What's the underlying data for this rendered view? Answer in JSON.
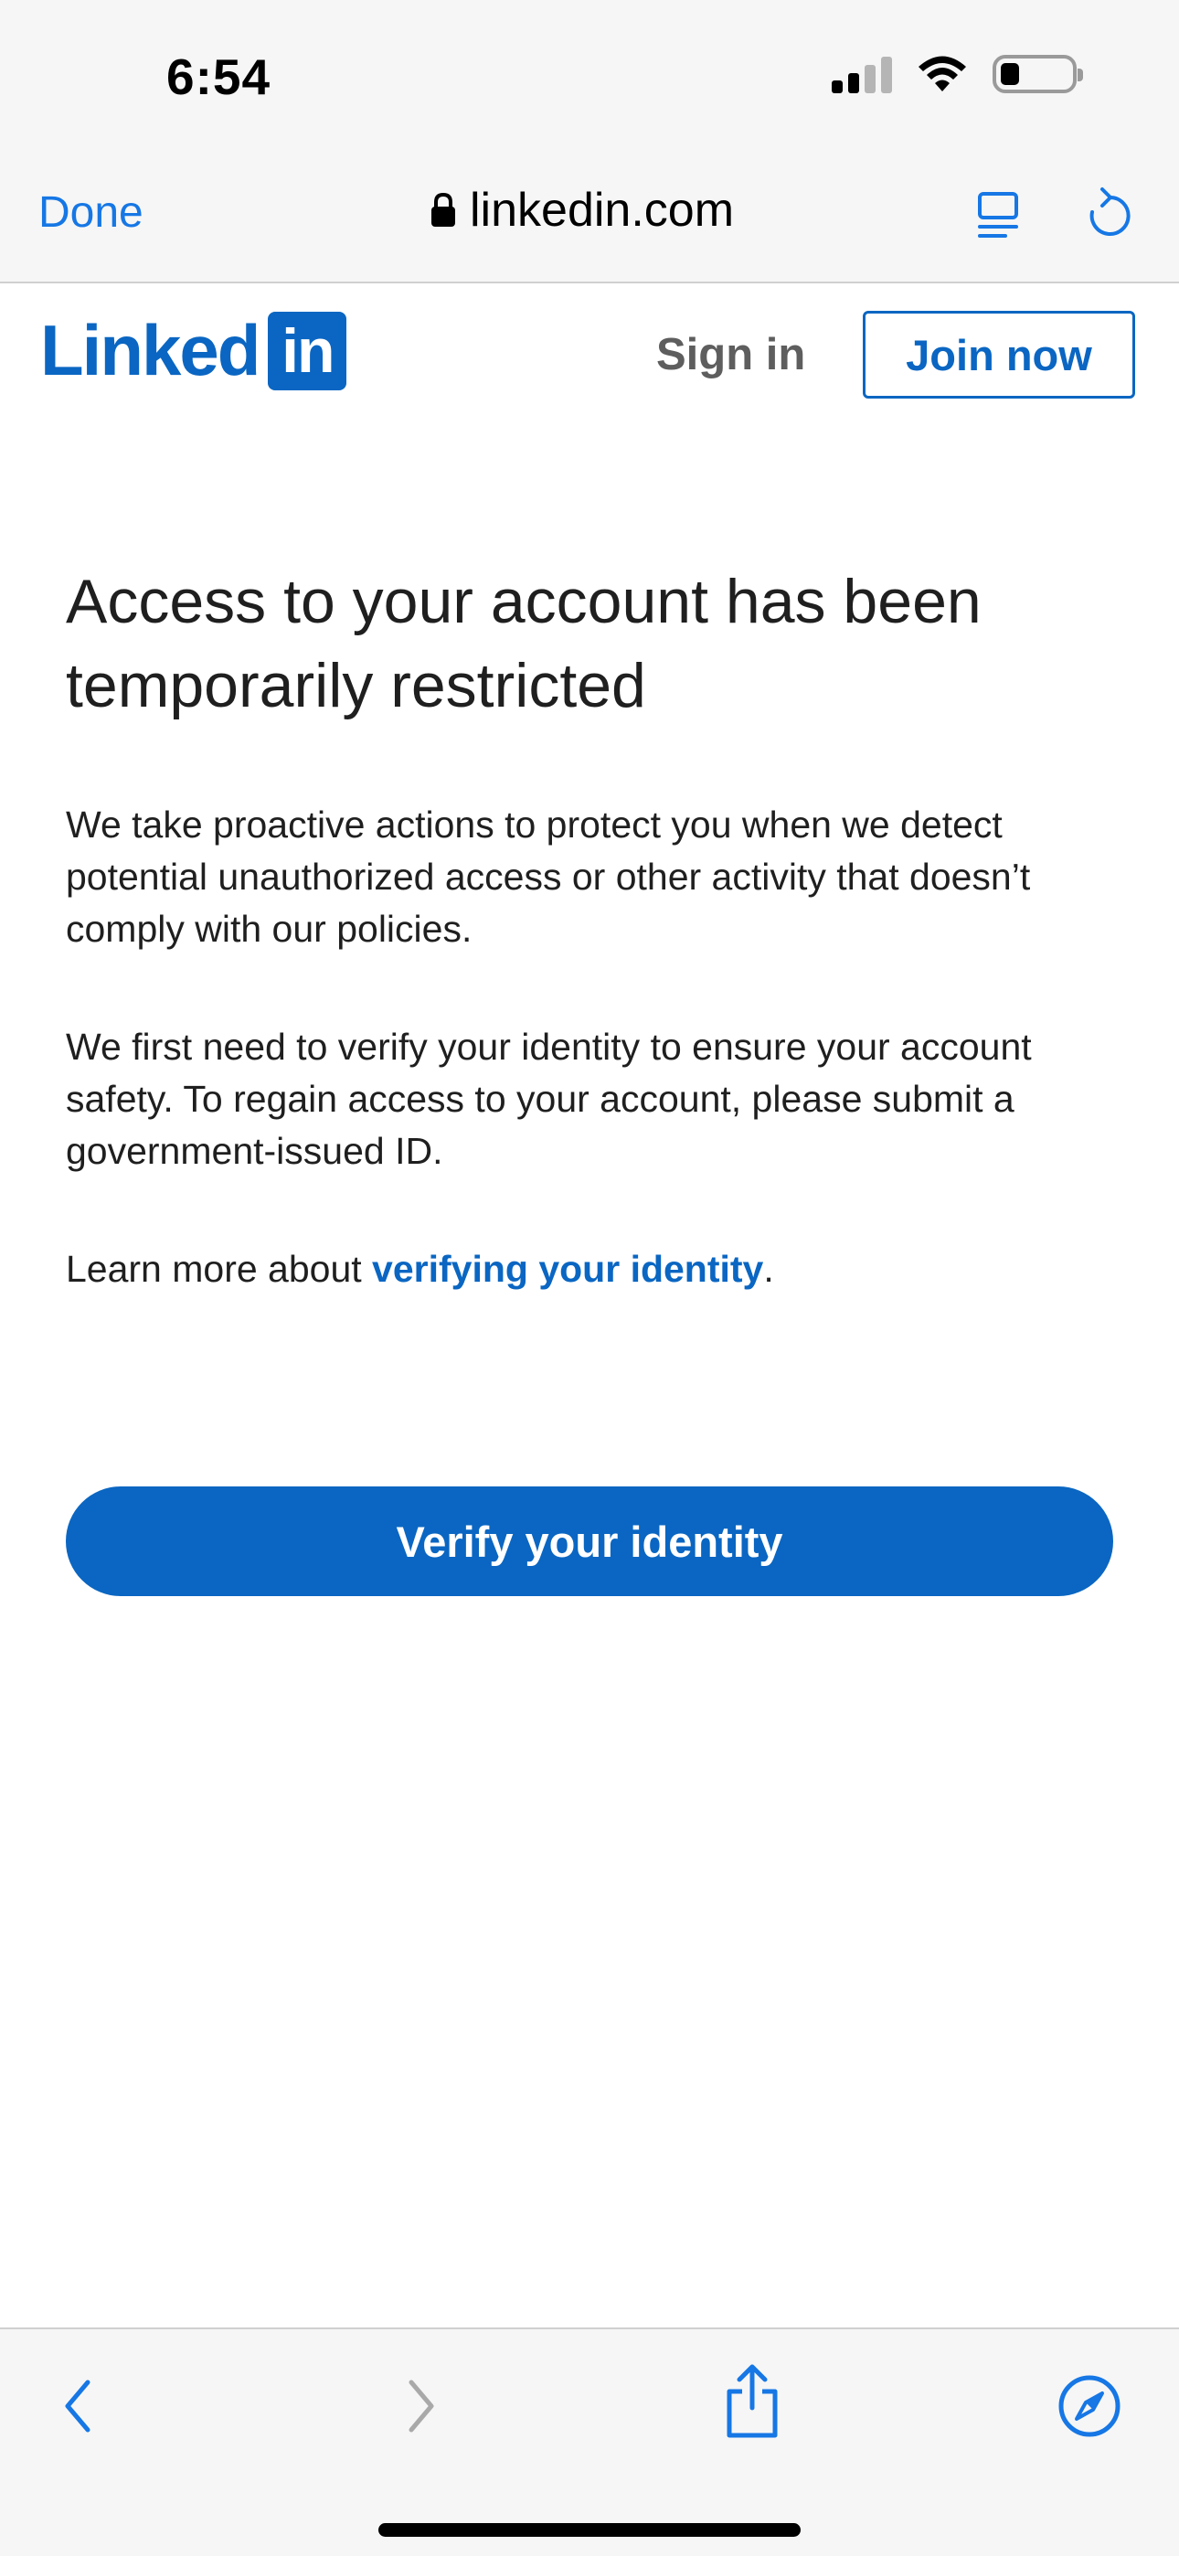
{
  "status_bar": {
    "time": "6:54"
  },
  "browser": {
    "done_label": "Done",
    "url": "linkedin.com",
    "accent_color": "#1677e5",
    "icons": [
      "lock-icon",
      "reader-icon",
      "reload-icon"
    ]
  },
  "header": {
    "logo_text": "Linked",
    "logo_box_text": "in",
    "sign_in_label": "Sign in",
    "join_label": "Join now",
    "brand_color": "#0a66c2"
  },
  "main": {
    "title": "Access to your account has been temporarily restricted",
    "paragraph1": "We take proactive actions to protect you when we detect potential unauthorized access or other activity that doesn’t comply with our policies.",
    "paragraph2": "We first need to verify your identity to ensure your account safety. To regain access to your account, please submit a government-issued ID.",
    "learn_prefix": "Learn more about ",
    "learn_link": "verifying your identity",
    "learn_suffix": ".",
    "verify_button": "Verify your identity"
  },
  "toolbar": {
    "icons": [
      "back-icon",
      "forward-icon",
      "share-icon",
      "compass-icon"
    ]
  }
}
